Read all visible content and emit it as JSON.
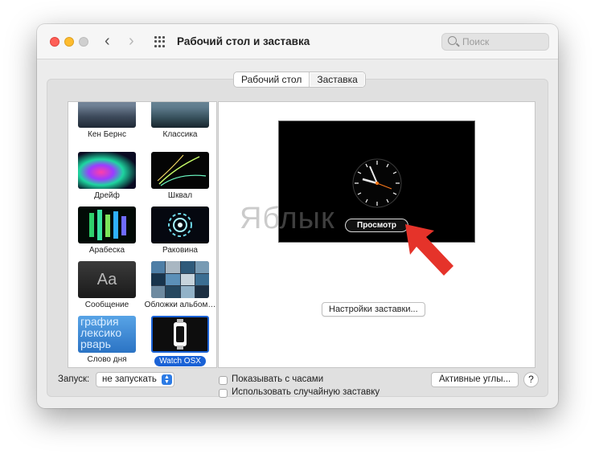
{
  "window": {
    "title": "Рабочий стол и заставка",
    "search_placeholder": "Поиск",
    "nav_back": "‹",
    "nav_forward": "›"
  },
  "tabs": [
    {
      "label": "Рабочий стол",
      "active": false
    },
    {
      "label": "Заставка",
      "active": true
    }
  ],
  "savers": [
    {
      "label": "Кен Бернс",
      "icon": "ken-burns-thumb"
    },
    {
      "label": "Классика",
      "icon": "classic-thumb"
    },
    {
      "label": "Дрейф",
      "icon": "drift-thumb"
    },
    {
      "label": "Шквал",
      "icon": "flurry-thumb"
    },
    {
      "label": "Арабеска",
      "icon": "arabesque-thumb"
    },
    {
      "label": "Раковина",
      "icon": "shell-thumb"
    },
    {
      "label": "Сообщение",
      "icon": "message-thumb",
      "thumb_text": "Aa"
    },
    {
      "label": "Обложки альбом…",
      "icon": "album-covers-thumb"
    },
    {
      "label": "Слово дня",
      "icon": "word-of-day-thumb",
      "thumb_text": "графия\nлексико\nрварь"
    },
    {
      "label": "Watch OSX",
      "icon": "watch-thumb",
      "selected": true
    }
  ],
  "preview": {
    "button_label": "Просмотр",
    "settings_button": "Настройки заставки...",
    "watermark": "Яблык",
    "accent_arrow_color": "#e5332a"
  },
  "bottom": {
    "launch_label": "Запуск:",
    "launch_value": "не запускать",
    "show_clock": "Показывать с часами",
    "random_saver": "Использовать случайную заставку",
    "hot_corners": "Активные углы...",
    "help": "?"
  }
}
